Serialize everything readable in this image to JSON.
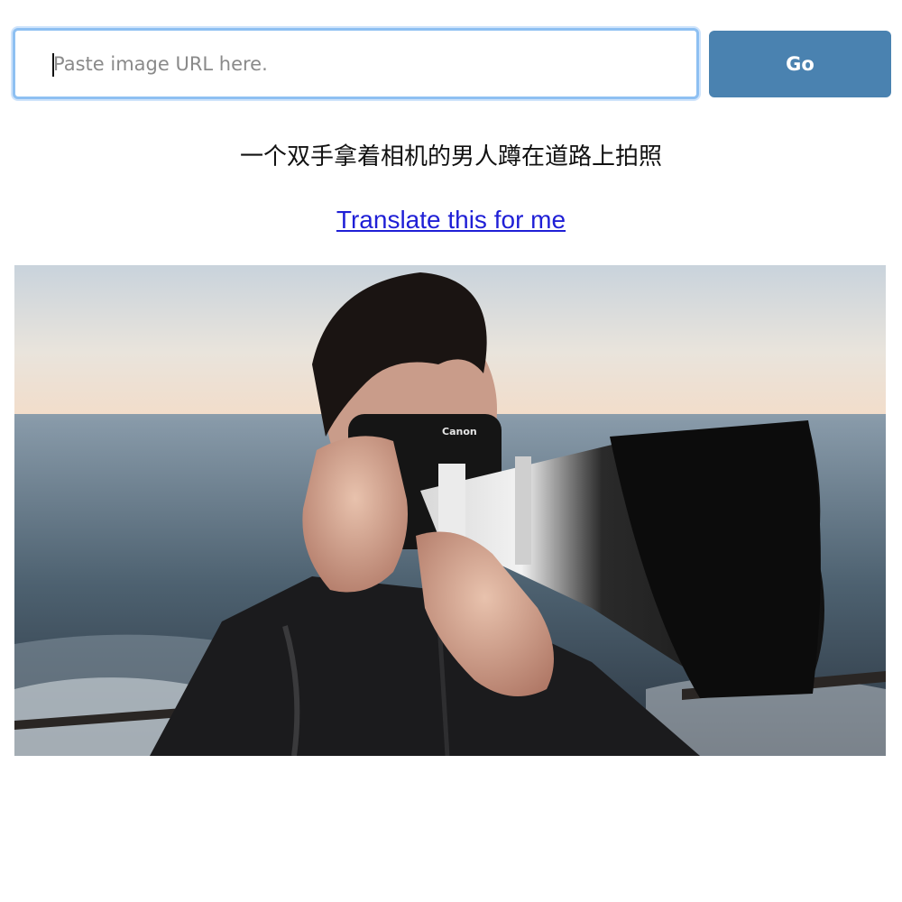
{
  "search": {
    "placeholder": "Paste image URL here.",
    "value": "",
    "go_label": "Go"
  },
  "result": {
    "caption": "一个双手拿着相机的男人蹲在道路上拍照",
    "translate_link": "Translate this for me"
  },
  "photo": {
    "camera_brand_text": "Canon"
  },
  "colors": {
    "button_bg": "#4a82b0",
    "input_focus_border": "#8ec0f2",
    "link": "#1f1fd6"
  }
}
